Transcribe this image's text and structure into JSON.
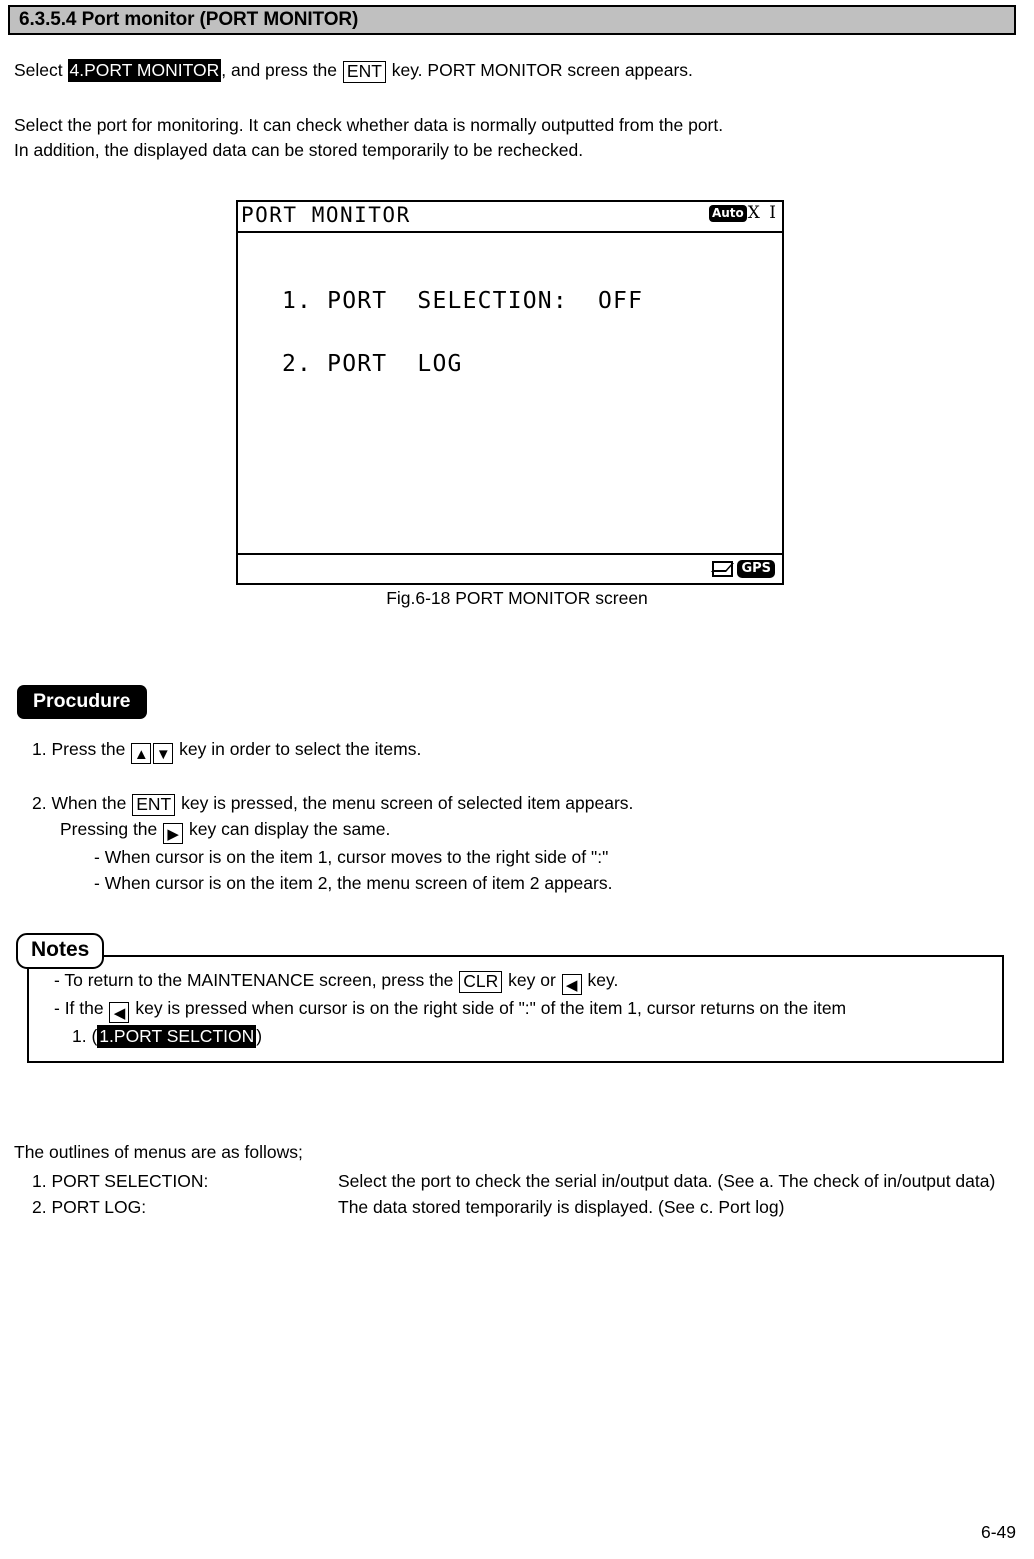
{
  "header": {
    "title": "6.3.5.4 Port monitor (PORT MONITOR)"
  },
  "intro": {
    "prefix": "Select ",
    "highlight": "4.PORT MONITOR",
    "middle": ", and press the ",
    "key": "ENT",
    "suffix": " key. PORT MONITOR screen appears."
  },
  "description": {
    "line1": "Select the port for monitoring. It can check whether data is normally outputted from the port.",
    "line2": "In addition, the displayed data can be stored temporarily to be rechecked."
  },
  "lcd": {
    "title": "PORT  MONITOR",
    "status_auto": "Auto",
    "status_xi": "X I",
    "menu_item_1": "1. PORT  SELECTION:  OFF",
    "menu_item_2": "2. PORT  LOG",
    "statusbar_mail_icon": "mail-icon",
    "statusbar_gps": "GPS"
  },
  "figure_caption": "Fig.6-18 PORT MONITOR screen",
  "procedure": {
    "tag": "Procudure",
    "step1": {
      "prefix": "1. Press the ",
      "key_up": "▲",
      "key_down": "▼",
      "suffix": " key in order to select the items."
    },
    "step2": {
      "prefix": "2. When the ",
      "key": "ENT",
      "suffix": " key is pressed, the menu screen of selected item appears.",
      "line2_prefix": "Pressing the ",
      "line2_key": "▶",
      "line2_suffix": " key can display the same.",
      "bullet1": "- When cursor is on the item 1, cursor moves to the right side of \":\"",
      "bullet2": "- When cursor is on the item 2, the menu screen of item 2 appears."
    }
  },
  "notes": {
    "tag": "Notes",
    "note1_prefix": "- To return to the MAINTENANCE screen, press the ",
    "note1_key": "CLR",
    "note1_middle": " key or ",
    "note1_key2": "◀",
    "note1_suffix": " key.",
    "note2_prefix": "- If the ",
    "note2_key": "◀",
    "note2_middle": " key is pressed when cursor is on the right side of \":\" of the item 1, cursor returns on the item",
    "note2_sub_prefix": "1. (",
    "note2_sub_highlight": "1.PORT SELCTION",
    "note2_sub_suffix": ")"
  },
  "outlines": {
    "heading": "The outlines of menus are as follows;",
    "rows": [
      {
        "label": "1. PORT SELECTION:",
        "description": "Select the port to check the serial in/output data. (See a. The check of in/output data)"
      },
      {
        "label": "2. PORT LOG:",
        "description": "The data stored temporarily is displayed. (See c. Port log)"
      }
    ]
  },
  "page_number": "6-49"
}
